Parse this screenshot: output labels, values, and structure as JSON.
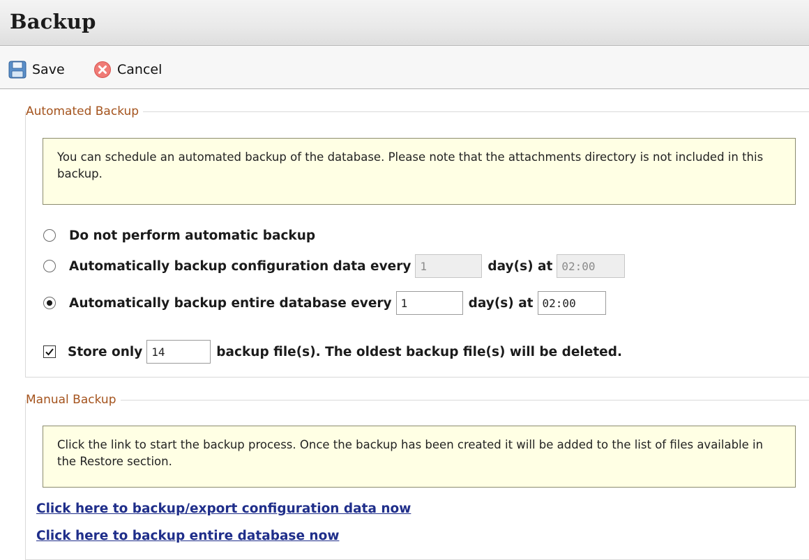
{
  "header": {
    "title": "Backup"
  },
  "toolbar": {
    "save_label": "Save",
    "save_icon": "floppy-disk-icon",
    "cancel_label": "Cancel",
    "cancel_icon": "cancel-circle-icon"
  },
  "automated": {
    "legend": "Automated Backup",
    "note": "You can schedule an automated backup of the database. Please note that the attachments directory is not included in this backup.",
    "options": [
      {
        "label": "Do not perform automatic backup",
        "checked": false
      },
      {
        "label": "Automatically backup configuration data every",
        "days_value": "1",
        "days_suffix": "day(s) at",
        "time_value": "02:00",
        "disabled": true,
        "checked": false
      },
      {
        "label": "Automatically backup entire database every",
        "days_value": "1",
        "days_suffix": "day(s) at",
        "time_value": "02:00",
        "disabled": false,
        "checked": true
      }
    ],
    "store": {
      "checked": true,
      "prefix": "Store only",
      "value": "14",
      "suffix": "backup file(s). The oldest backup file(s) will be deleted."
    }
  },
  "manual": {
    "legend": "Manual Backup",
    "note": "Click the link to start the backup process. Once the backup has been created it will be added to the list of files available in the Restore section.",
    "links": [
      "Click here to backup/export configuration data now",
      "Click here to backup entire database now"
    ]
  },
  "colors": {
    "legend": "#a4531d",
    "note_bg": "#ffffe4",
    "link": "#1f2e8a"
  }
}
